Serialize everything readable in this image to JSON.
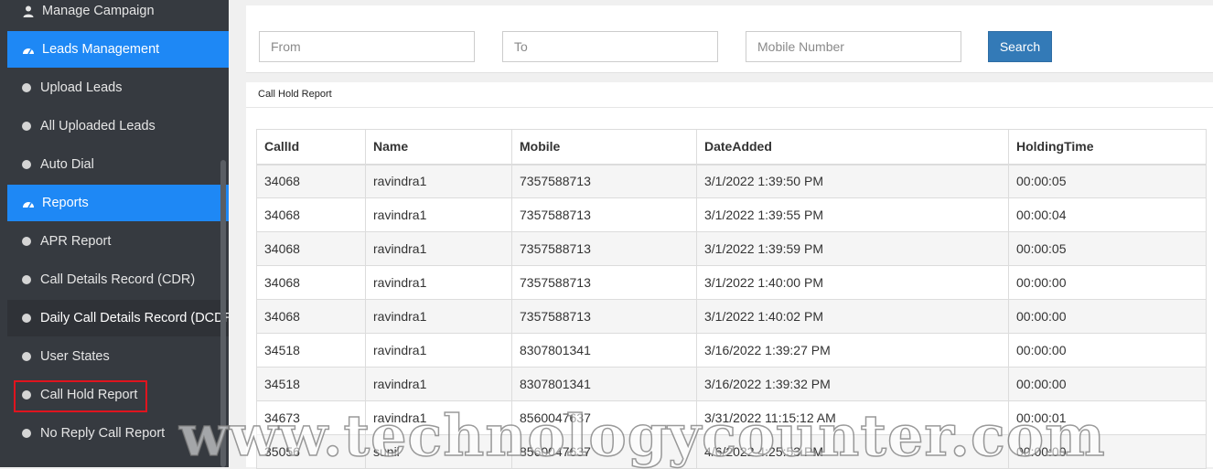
{
  "sidebar": {
    "items": [
      {
        "label": "Manage Campaign",
        "icon": "user-icon",
        "state": "normal"
      },
      {
        "label": "Leads Management",
        "icon": "dashboard-icon",
        "state": "active"
      },
      {
        "label": "Upload Leads",
        "icon": "dot-icon",
        "state": "normal"
      },
      {
        "label": "All Uploaded Leads",
        "icon": "dot-icon",
        "state": "normal"
      },
      {
        "label": "Auto Dial",
        "icon": "dot-icon",
        "state": "normal"
      },
      {
        "label": "Reports",
        "icon": "dashboard-icon",
        "state": "active"
      },
      {
        "label": "APR Report",
        "icon": "dot-icon",
        "state": "normal"
      },
      {
        "label": "Call Details Record (CDR)",
        "icon": "dot-icon",
        "state": "normal"
      },
      {
        "label": "Daily Call Details Record (DCDR)",
        "icon": "dot-icon",
        "state": "highlight"
      },
      {
        "label": "User States",
        "icon": "dot-icon",
        "state": "normal"
      },
      {
        "label": "Call Hold Report",
        "icon": "dot-icon",
        "state": "selected"
      },
      {
        "label": "No Reply Call Report",
        "icon": "dot-icon",
        "state": "normal"
      }
    ]
  },
  "filters": {
    "from_placeholder": "From",
    "to_placeholder": "To",
    "mobile_placeholder": "Mobile Number",
    "search_label": "Search"
  },
  "report": {
    "title": "Call Hold Report",
    "columns": [
      "CallId",
      "Name",
      "Mobile",
      "DateAdded",
      "HoldingTime"
    ],
    "rows": [
      [
        "34068",
        "ravindra1",
        "7357588713",
        "3/1/2022 1:39:50 PM",
        "00:00:05"
      ],
      [
        "34068",
        "ravindra1",
        "7357588713",
        "3/1/2022 1:39:55 PM",
        "00:00:04"
      ],
      [
        "34068",
        "ravindra1",
        "7357588713",
        "3/1/2022 1:39:59 PM",
        "00:00:05"
      ],
      [
        "34068",
        "ravindra1",
        "7357588713",
        "3/1/2022 1:40:00 PM",
        "00:00:00"
      ],
      [
        "34068",
        "ravindra1",
        "7357588713",
        "3/1/2022 1:40:02 PM",
        "00:00:00"
      ],
      [
        "34518",
        "ravindra1",
        "8307801341",
        "3/16/2022 1:39:27 PM",
        "00:00:00"
      ],
      [
        "34518",
        "ravindra1",
        "8307801341",
        "3/16/2022 1:39:32 PM",
        "00:00:00"
      ],
      [
        "34673",
        "ravindra1",
        "8560047637",
        "3/31/2022 11:15:12 AM",
        "00:00:01"
      ],
      [
        "35056",
        "sunil",
        "8560047637",
        "4/6/2022 4:25:53 PM",
        "00:00:00"
      ]
    ]
  },
  "watermark": "www.technologycounter.com",
  "colors": {
    "sidebar_bg": "#363a40",
    "active_bg": "#1e88f5",
    "search_btn": "#337ab7",
    "selected_outline": "#e0141e"
  }
}
